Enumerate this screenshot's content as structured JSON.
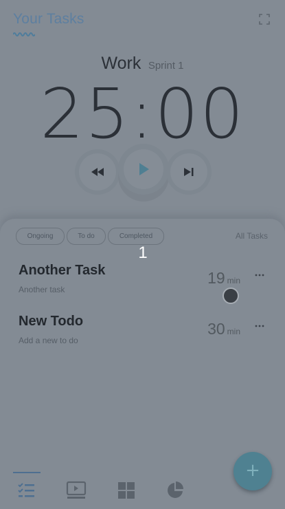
{
  "header": {
    "title": "Your Tasks",
    "expand_icon": "fullscreen-icon"
  },
  "timer": {
    "mode": "Work",
    "sprint": "Sprint 1",
    "time": "25:00"
  },
  "controls": {
    "rewind_icon": "rewind-icon",
    "play_icon": "play-icon",
    "skip_icon": "skip-next-icon"
  },
  "filters": {
    "chips": [
      "Ongoing",
      "To do",
      "Completed"
    ],
    "all_tasks": "All Tasks"
  },
  "completed_count": "1",
  "tasks": [
    {
      "title": "Another Task",
      "description": "Another task",
      "minutes": "19",
      "unit": "min"
    },
    {
      "title": "New Todo",
      "description": "Add a new to do",
      "minutes": "30",
      "unit": "min"
    }
  ],
  "fab": {
    "label": "+"
  },
  "nav": {
    "items": [
      "tasks-icon",
      "focus-screen-icon",
      "grid-icon",
      "pie-chart-icon"
    ],
    "active": "tasks-icon"
  },
  "colors": {
    "background": "#838b94",
    "accent": "#5d7fa0",
    "fab": "#4f8191"
  }
}
